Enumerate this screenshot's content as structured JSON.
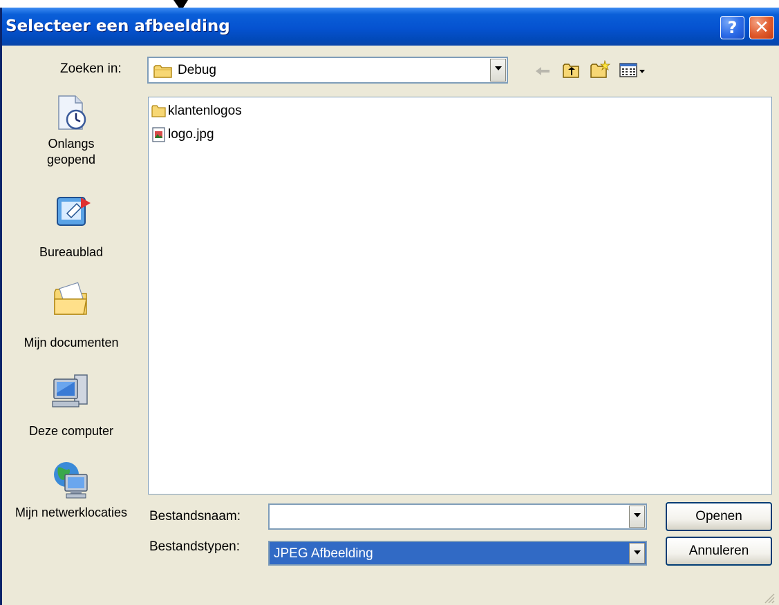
{
  "dialog": {
    "title": "Selecteer een afbeelding",
    "help_label": "?",
    "close_label": "✕"
  },
  "toolbar": {
    "lookin_label": "Zoeken in:",
    "lookin_value": "Debug",
    "icons": [
      "back-arrow-icon",
      "up-one-level-icon",
      "new-folder-icon",
      "view-menu-icon"
    ]
  },
  "places": [
    {
      "name": "recent",
      "label": "Onlangs geopend",
      "icon": "recent-documents-icon"
    },
    {
      "name": "desktop",
      "label": "Bureaublad",
      "icon": "desktop-icon"
    },
    {
      "name": "my-documents",
      "label": "Mijn documenten",
      "icon": "my-documents-icon"
    },
    {
      "name": "my-computer",
      "label": "Deze computer",
      "icon": "my-computer-icon"
    },
    {
      "name": "network",
      "label": "Mijn netwerklocaties",
      "icon": "network-places-icon"
    }
  ],
  "files": [
    {
      "name": "klantenlogos",
      "type": "folder"
    },
    {
      "name": "logo.jpg",
      "type": "image"
    }
  ],
  "filename": {
    "label": "Bestandsnaam:",
    "value": ""
  },
  "filetype": {
    "label": "Bestandstypen:",
    "value": "JPEG Afbeelding"
  },
  "buttons": {
    "open": "Openen",
    "cancel": "Annuleren"
  },
  "colors": {
    "titlebar": "#0552d0",
    "selection": "#316ac5",
    "dialog_bg": "#ece9d8"
  }
}
